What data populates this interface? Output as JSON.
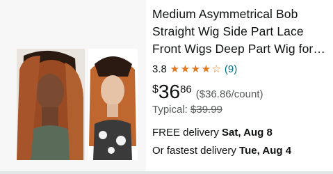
{
  "product": {
    "title": "Medium Asymmetrical Bob Straight Wig Side Part Lace Front Wigs Deep Part Wig for…",
    "rating": "3.8",
    "stars": 3.8,
    "review_count": "(9)",
    "price_symbol": "$",
    "price_whole": "36",
    "price_fraction": "86",
    "unit_price": "($36.86/count)",
    "typical_label": "Typical:",
    "typical_price": "$39.99",
    "delivery_prefix": "FREE delivery",
    "delivery_date": "Sat, Aug 8",
    "fastest_prefix": "Or fastest delivery",
    "fastest_date": "Tue, Aug 4"
  },
  "colors": {
    "star": "#de7921",
    "link": "#007185",
    "muted": "#565959"
  }
}
